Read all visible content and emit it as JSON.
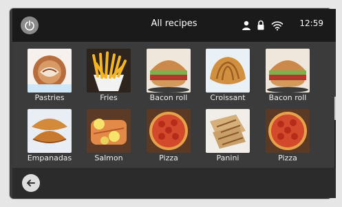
{
  "topbar": {
    "title": "All recipes",
    "time": "12:59",
    "icons": [
      "power-icon",
      "user-icon",
      "lock-icon",
      "wifi-icon"
    ]
  },
  "recipes": [
    {
      "label": "Pastries",
      "icon": "pastries-image"
    },
    {
      "label": "Fries",
      "icon": "fries-image"
    },
    {
      "label": "Bacon roll",
      "icon": "bacon-roll-image"
    },
    {
      "label": "Croissant",
      "icon": "croissant-image"
    },
    {
      "label": "Bacon roll",
      "icon": "bacon-roll-image"
    },
    {
      "label": "Empanadas",
      "icon": "empanadas-image"
    },
    {
      "label": "Salmon",
      "icon": "salmon-image"
    },
    {
      "label": "Pizza",
      "icon": "pizza-image"
    },
    {
      "label": "Panini",
      "icon": "panini-image"
    },
    {
      "label": "Pizza",
      "icon": "pizza-image"
    }
  ],
  "bottombar": {
    "icons": [
      "back-arrow-icon"
    ]
  },
  "colors": {
    "topbar": "#1a1a1a",
    "screen": "#3b3b3b",
    "bottombar": "#2b2b2b",
    "text": "#f0f0f0"
  }
}
